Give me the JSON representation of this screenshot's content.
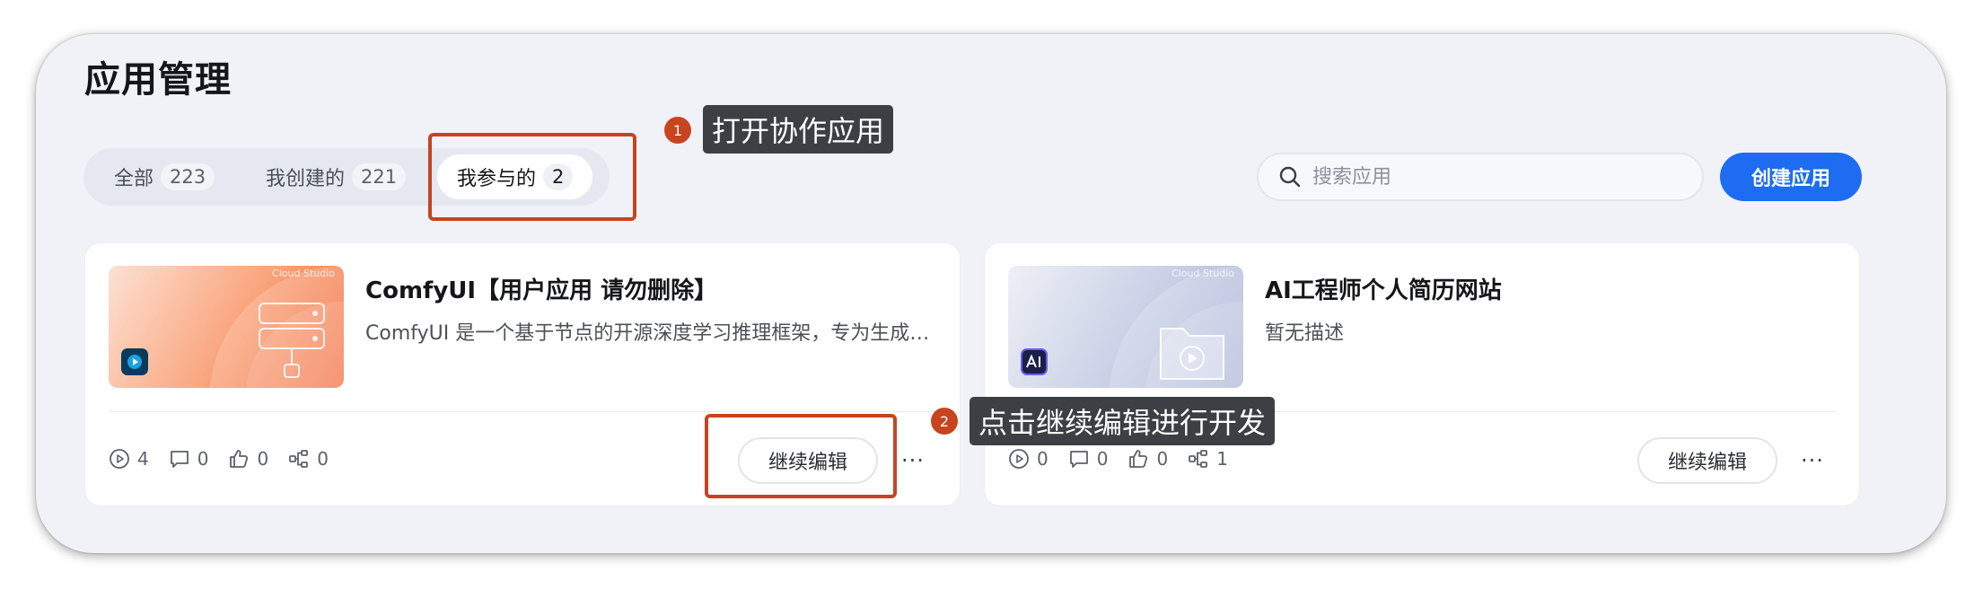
{
  "page": {
    "title": "应用管理"
  },
  "tabs": [
    {
      "label": "全部",
      "count": "223"
    },
    {
      "label": "我创建的",
      "count": "221"
    },
    {
      "label": "我参与的",
      "count": "2"
    }
  ],
  "search": {
    "placeholder": "搜索应用",
    "value": ""
  },
  "create_button": "创建应用",
  "annotations": [
    {
      "number": "1",
      "text": "打开协作应用"
    },
    {
      "number": "2",
      "text": "点击继续编辑进行开发"
    }
  ],
  "cards": [
    {
      "thumb_caption": "Cloud Studio",
      "title": "ComfyUI【用户应用 请勿删除】",
      "description": "ComfyUI 是一个基于节点的开源深度学习推理框架，专为生成式AI设计",
      "stats": {
        "runs": "4",
        "comments": "0",
        "likes": "0",
        "forks": "0"
      },
      "edit_label": "继续编辑",
      "more_label": "···",
      "accent": "#f36c3e"
    },
    {
      "thumb_caption": "Cloud Studio",
      "title": "AI工程师个人简历网站",
      "description": "暂无描述",
      "stats": {
        "runs": "0",
        "comments": "0",
        "likes": "0",
        "forks": "1"
      },
      "edit_label": "继续编辑",
      "more_label": "···",
      "accent": "#a8b3d6"
    }
  ],
  "colors": {
    "primary": "#1d6cf2",
    "annotation": "#c7441f",
    "callout_bg": "#3c3f44"
  }
}
